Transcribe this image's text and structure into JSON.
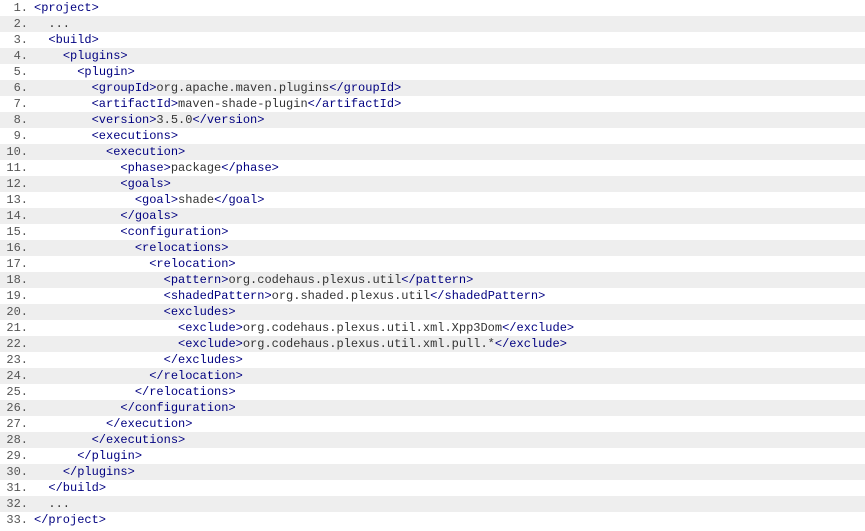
{
  "lines": [
    {
      "num": "1.",
      "segments": [
        {
          "cls": "tag",
          "text": "<project>"
        }
      ]
    },
    {
      "num": "2.",
      "segments": [
        {
          "cls": "plain",
          "text": "  ..."
        }
      ]
    },
    {
      "num": "3.",
      "segments": [
        {
          "cls": "plain",
          "text": "  "
        },
        {
          "cls": "tag",
          "text": "<build>"
        }
      ]
    },
    {
      "num": "4.",
      "segments": [
        {
          "cls": "plain",
          "text": "    "
        },
        {
          "cls": "tag",
          "text": "<plugins>"
        }
      ]
    },
    {
      "num": "5.",
      "segments": [
        {
          "cls": "plain",
          "text": "      "
        },
        {
          "cls": "tag",
          "text": "<plugin>"
        }
      ]
    },
    {
      "num": "6.",
      "segments": [
        {
          "cls": "plain",
          "text": "        "
        },
        {
          "cls": "tag",
          "text": "<groupId>"
        },
        {
          "cls": "plain",
          "text": "org.apache.maven.plugins"
        },
        {
          "cls": "tag",
          "text": "</groupId>"
        }
      ]
    },
    {
      "num": "7.",
      "segments": [
        {
          "cls": "plain",
          "text": "        "
        },
        {
          "cls": "tag",
          "text": "<artifactId>"
        },
        {
          "cls": "plain",
          "text": "maven-shade-plugin"
        },
        {
          "cls": "tag",
          "text": "</artifactId>"
        }
      ]
    },
    {
      "num": "8.",
      "segments": [
        {
          "cls": "plain",
          "text": "        "
        },
        {
          "cls": "tag",
          "text": "<version>"
        },
        {
          "cls": "plain",
          "text": "3.5.0"
        },
        {
          "cls": "tag",
          "text": "</version>"
        }
      ]
    },
    {
      "num": "9.",
      "segments": [
        {
          "cls": "plain",
          "text": "        "
        },
        {
          "cls": "tag",
          "text": "<executions>"
        }
      ]
    },
    {
      "num": "10.",
      "segments": [
        {
          "cls": "plain",
          "text": "          "
        },
        {
          "cls": "tag",
          "text": "<execution>"
        }
      ]
    },
    {
      "num": "11.",
      "segments": [
        {
          "cls": "plain",
          "text": "            "
        },
        {
          "cls": "tag",
          "text": "<phase>"
        },
        {
          "cls": "plain",
          "text": "package"
        },
        {
          "cls": "tag",
          "text": "</phase>"
        }
      ]
    },
    {
      "num": "12.",
      "segments": [
        {
          "cls": "plain",
          "text": "            "
        },
        {
          "cls": "tag",
          "text": "<goals>"
        }
      ]
    },
    {
      "num": "13.",
      "segments": [
        {
          "cls": "plain",
          "text": "              "
        },
        {
          "cls": "tag",
          "text": "<goal>"
        },
        {
          "cls": "plain",
          "text": "shade"
        },
        {
          "cls": "tag",
          "text": "</goal>"
        }
      ]
    },
    {
      "num": "14.",
      "segments": [
        {
          "cls": "plain",
          "text": "            "
        },
        {
          "cls": "tag",
          "text": "</goals>"
        }
      ]
    },
    {
      "num": "15.",
      "segments": [
        {
          "cls": "plain",
          "text": "            "
        },
        {
          "cls": "tag",
          "text": "<configuration>"
        }
      ]
    },
    {
      "num": "16.",
      "segments": [
        {
          "cls": "plain",
          "text": "              "
        },
        {
          "cls": "tag",
          "text": "<relocations>"
        }
      ]
    },
    {
      "num": "17.",
      "segments": [
        {
          "cls": "plain",
          "text": "                "
        },
        {
          "cls": "tag",
          "text": "<relocation>"
        }
      ]
    },
    {
      "num": "18.",
      "segments": [
        {
          "cls": "plain",
          "text": "                  "
        },
        {
          "cls": "tag",
          "text": "<pattern>"
        },
        {
          "cls": "plain",
          "text": "org.codehaus.plexus.util"
        },
        {
          "cls": "tag",
          "text": "</pattern>"
        }
      ]
    },
    {
      "num": "19.",
      "segments": [
        {
          "cls": "plain",
          "text": "                  "
        },
        {
          "cls": "tag",
          "text": "<shadedPattern>"
        },
        {
          "cls": "plain",
          "text": "org.shaded.plexus.util"
        },
        {
          "cls": "tag",
          "text": "</shadedPattern>"
        }
      ]
    },
    {
      "num": "20.",
      "segments": [
        {
          "cls": "plain",
          "text": "                  "
        },
        {
          "cls": "tag",
          "text": "<excludes>"
        }
      ]
    },
    {
      "num": "21.",
      "segments": [
        {
          "cls": "plain",
          "text": "                    "
        },
        {
          "cls": "tag",
          "text": "<exclude>"
        },
        {
          "cls": "plain",
          "text": "org.codehaus.plexus.util.xml.Xpp3Dom"
        },
        {
          "cls": "tag",
          "text": "</exclude>"
        }
      ]
    },
    {
      "num": "22.",
      "segments": [
        {
          "cls": "plain",
          "text": "                    "
        },
        {
          "cls": "tag",
          "text": "<exclude>"
        },
        {
          "cls": "plain",
          "text": "org.codehaus.plexus.util.xml.pull.*"
        },
        {
          "cls": "tag",
          "text": "</exclude>"
        }
      ]
    },
    {
      "num": "23.",
      "segments": [
        {
          "cls": "plain",
          "text": "                  "
        },
        {
          "cls": "tag",
          "text": "</excludes>"
        }
      ]
    },
    {
      "num": "24.",
      "segments": [
        {
          "cls": "plain",
          "text": "                "
        },
        {
          "cls": "tag",
          "text": "</relocation>"
        }
      ]
    },
    {
      "num": "25.",
      "segments": [
        {
          "cls": "plain",
          "text": "              "
        },
        {
          "cls": "tag",
          "text": "</relocations>"
        }
      ]
    },
    {
      "num": "26.",
      "segments": [
        {
          "cls": "plain",
          "text": "            "
        },
        {
          "cls": "tag",
          "text": "</configuration>"
        }
      ]
    },
    {
      "num": "27.",
      "segments": [
        {
          "cls": "plain",
          "text": "          "
        },
        {
          "cls": "tag",
          "text": "</execution>"
        }
      ]
    },
    {
      "num": "28.",
      "segments": [
        {
          "cls": "plain",
          "text": "        "
        },
        {
          "cls": "tag",
          "text": "</executions>"
        }
      ]
    },
    {
      "num": "29.",
      "segments": [
        {
          "cls": "plain",
          "text": "      "
        },
        {
          "cls": "tag",
          "text": "</plugin>"
        }
      ]
    },
    {
      "num": "30.",
      "segments": [
        {
          "cls": "plain",
          "text": "    "
        },
        {
          "cls": "tag",
          "text": "</plugins>"
        }
      ]
    },
    {
      "num": "31.",
      "segments": [
        {
          "cls": "plain",
          "text": "  "
        },
        {
          "cls": "tag",
          "text": "</build>"
        }
      ]
    },
    {
      "num": "32.",
      "segments": [
        {
          "cls": "plain",
          "text": "  ..."
        }
      ]
    },
    {
      "num": "33.",
      "segments": [
        {
          "cls": "tag",
          "text": "</project>"
        }
      ]
    }
  ]
}
